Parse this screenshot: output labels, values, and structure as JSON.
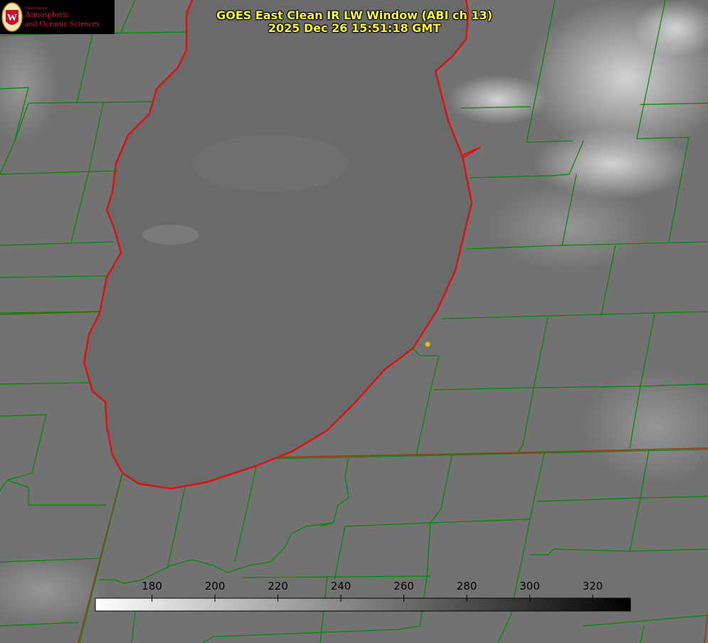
{
  "title": {
    "line1": "GOES East Clean IR LW Window (ABI ch 13)",
    "line2": "2025 Dec 26 15:51:18 GMT"
  },
  "logo": {
    "dept": "Department of",
    "line1": "Atmospheric",
    "line2": "and Oceanic Sciences",
    "icon": "uw-crest-icon"
  },
  "colorbar": {
    "ticks": [
      "180",
      "200",
      "220",
      "240",
      "260",
      "280",
      "300",
      "320"
    ],
    "tick_values": [
      180,
      200,
      220,
      240,
      260,
      280,
      300,
      320
    ],
    "range": [
      162,
      332
    ],
    "colormap": "white-to-black grayscale"
  },
  "colors": {
    "title": "#ffff33",
    "county_lines": "#008800",
    "shoreline": "#e01010",
    "state_lines": "#8b4513",
    "marker": "#e6c200"
  }
}
